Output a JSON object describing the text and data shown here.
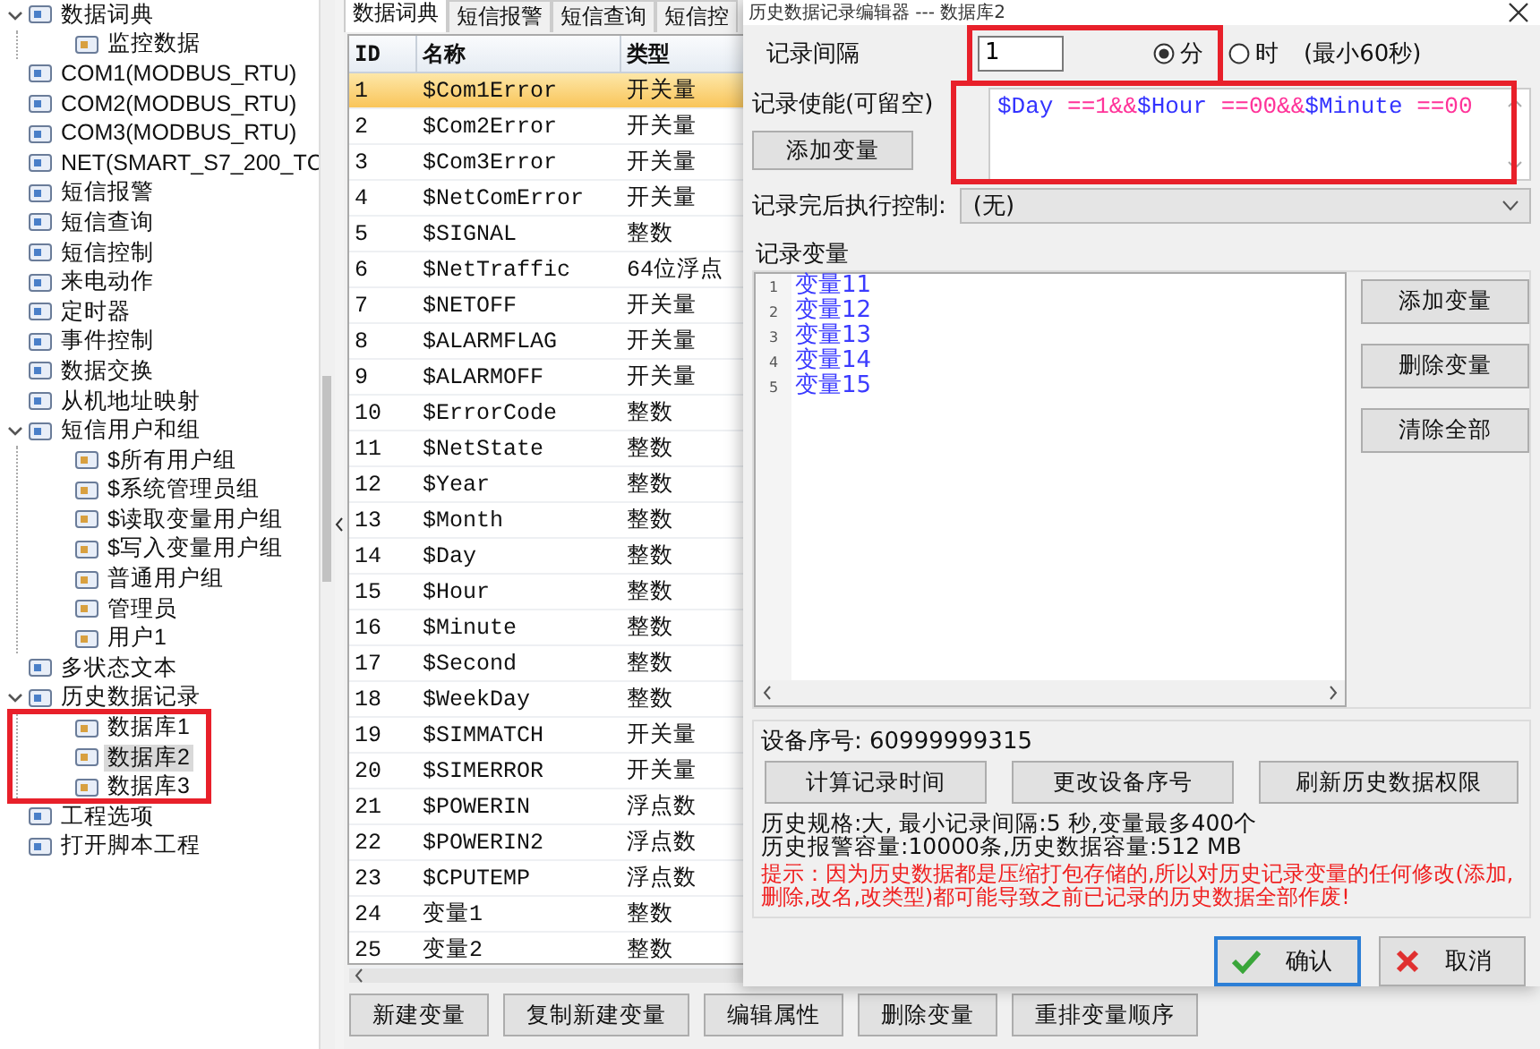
{
  "tree": [
    {
      "label": "数据词典",
      "expanded": true,
      "selected": false,
      "children": [
        {
          "label": "监控数据",
          "selected": false
        }
      ]
    },
    {
      "label": "COM1(MODBUS_RTU)",
      "selected": false
    },
    {
      "label": "COM2(MODBUS_RTU)",
      "selected": false
    },
    {
      "label": "COM3(MODBUS_RTU)",
      "selected": false
    },
    {
      "label": "NET(SMART_S7_200_TC",
      "selected": false
    },
    {
      "label": "短信报警",
      "selected": false
    },
    {
      "label": "短信查询",
      "selected": false
    },
    {
      "label": "短信控制",
      "selected": false
    },
    {
      "label": "来电动作",
      "selected": false
    },
    {
      "label": "定时器",
      "selected": false
    },
    {
      "label": "事件控制",
      "selected": false
    },
    {
      "label": "数据交换",
      "selected": false
    },
    {
      "label": "从机地址映射",
      "selected": false
    },
    {
      "label": "短信用户和组",
      "expanded": true,
      "selected": false,
      "children": [
        {
          "label": "$所有用户组",
          "selected": false
        },
        {
          "label": "$系统管理员组",
          "selected": false
        },
        {
          "label": "$读取变量用户组",
          "selected": false
        },
        {
          "label": "$写入变量用户组",
          "selected": false
        },
        {
          "label": "普通用户组",
          "selected": false
        },
        {
          "label": "管理员",
          "selected": false
        },
        {
          "label": "用户1",
          "selected": false
        }
      ]
    },
    {
      "label": "多状态文本",
      "selected": false
    },
    {
      "label": "历史数据记录",
      "expanded": true,
      "selected": false,
      "children": [
        {
          "label": "数据库1",
          "selected": false
        },
        {
          "label": "数据库2",
          "selected": true
        },
        {
          "label": "数据库3",
          "selected": false
        }
      ]
    },
    {
      "label": "工程选项",
      "selected": false
    },
    {
      "label": "打开脚本工程",
      "selected": false
    }
  ],
  "tabs": [
    {
      "label": "数据词典",
      "selected": true
    },
    {
      "label": "短信报警",
      "selected": false
    },
    {
      "label": "短信查询",
      "selected": false
    },
    {
      "label": "短信控",
      "selected": false
    }
  ],
  "table": {
    "columns": [
      "ID",
      "名称",
      "类型"
    ],
    "rows": [
      {
        "cells": [
          "1",
          "$Com1Error",
          "开关量"
        ],
        "selected": true
      },
      {
        "cells": [
          "2",
          "$Com2Error",
          "开关量"
        ],
        "selected": false
      },
      {
        "cells": [
          "3",
          "$Com3Error",
          "开关量"
        ],
        "selected": false
      },
      {
        "cells": [
          "4",
          "$NetComError",
          "开关量"
        ],
        "selected": false
      },
      {
        "cells": [
          "5",
          "$SIGNAL",
          "整数"
        ],
        "selected": false
      },
      {
        "cells": [
          "6",
          "$NetTraffic",
          "64位浮点"
        ],
        "selected": false
      },
      {
        "cells": [
          "7",
          "$NETOFF",
          "开关量"
        ],
        "selected": false
      },
      {
        "cells": [
          "8",
          "$ALARMFLAG",
          "开关量"
        ],
        "selected": false
      },
      {
        "cells": [
          "9",
          "$ALARMOFF",
          "开关量"
        ],
        "selected": false
      },
      {
        "cells": [
          "10",
          "$ErrorCode",
          "整数"
        ],
        "selected": false
      },
      {
        "cells": [
          "11",
          "$NetState",
          "整数"
        ],
        "selected": false
      },
      {
        "cells": [
          "12",
          "$Year",
          "整数"
        ],
        "selected": false
      },
      {
        "cells": [
          "13",
          "$Month",
          "整数"
        ],
        "selected": false
      },
      {
        "cells": [
          "14",
          "$Day",
          "整数"
        ],
        "selected": false
      },
      {
        "cells": [
          "15",
          "$Hour",
          "整数"
        ],
        "selected": false
      },
      {
        "cells": [
          "16",
          "$Minute",
          "整数"
        ],
        "selected": false
      },
      {
        "cells": [
          "17",
          "$Second",
          "整数"
        ],
        "selected": false
      },
      {
        "cells": [
          "18",
          "$WeekDay",
          "整数"
        ],
        "selected": false
      },
      {
        "cells": [
          "19",
          "$SIMMATCH",
          "开关量"
        ],
        "selected": false
      },
      {
        "cells": [
          "20",
          "$SIMERROR",
          "开关量"
        ],
        "selected": false
      },
      {
        "cells": [
          "21",
          "$POWERIN",
          "浮点数"
        ],
        "selected": false
      },
      {
        "cells": [
          "22",
          "$POWERIN2",
          "浮点数"
        ],
        "selected": false
      },
      {
        "cells": [
          "23",
          "$CPUTEMP",
          "浮点数"
        ],
        "selected": false
      },
      {
        "cells": [
          "24",
          "变量1",
          "整数"
        ],
        "selected": false
      },
      {
        "cells": [
          "25",
          "变量2",
          "整数"
        ],
        "selected": false
      }
    ]
  },
  "toolbar_buttons": [
    "新建变量",
    "复制新建变量",
    "编辑属性",
    "删除变量",
    "重排变量顺序"
  ],
  "dialog": {
    "title": "历史数据记录编辑器 --- 数据库2",
    "interval": {
      "label": "记录间隔",
      "value": "1",
      "units": [
        {
          "label": "分",
          "selected": true
        },
        {
          "label": "时",
          "selected": false
        }
      ],
      "hint": "(最小60秒)"
    },
    "enable": {
      "label": "记录使能(可留空)",
      "tokens": [
        {
          "text": "$Day",
          "color": "#3333ff"
        },
        {
          "text": " ==1&&",
          "color": "#ff3399"
        },
        {
          "text": "$Hour",
          "color": "#3333ff"
        },
        {
          "text": " ==00&&",
          "color": "#ff3399"
        },
        {
          "text": "$Minute",
          "color": "#3333ff"
        },
        {
          "text": " ==00",
          "color": "#ff3399"
        }
      ],
      "button": "添加变量"
    },
    "after_control": {
      "label": "记录完后执行控制:",
      "value": "(无)"
    },
    "variables": {
      "label": "记录变量",
      "lines": [
        {
          "number": "1",
          "text": "变量11"
        },
        {
          "number": "2",
          "text": "变量12"
        },
        {
          "number": "3",
          "text": "变量13"
        },
        {
          "number": "4",
          "text": "变量14"
        },
        {
          "number": "5",
          "text": "变量15"
        }
      ],
      "buttons": [
        "添加变量",
        "删除变量",
        "清除全部"
      ]
    },
    "device": {
      "label": "设备序号: 60999999315",
      "buttons": [
        "计算记录时间",
        "更改设备序号",
        "刷新历史数据权限"
      ],
      "info": [
        "历史规格:大, 最小记录间隔:5 秒,变量最多400个",
        "历史报警容量:10000条,历史数据容量:512 MB"
      ],
      "warning": "提示：因为历史数据都是压缩打包存储的,所以对历史记录变量的任何修改(添加,删除,改名,改类型)都可能导致之前已记录的历史数据全部作废!"
    },
    "buttons": [
      {
        "label": "确认",
        "kind": "ok"
      },
      {
        "label": "取消",
        "kind": "cancel"
      }
    ]
  }
}
